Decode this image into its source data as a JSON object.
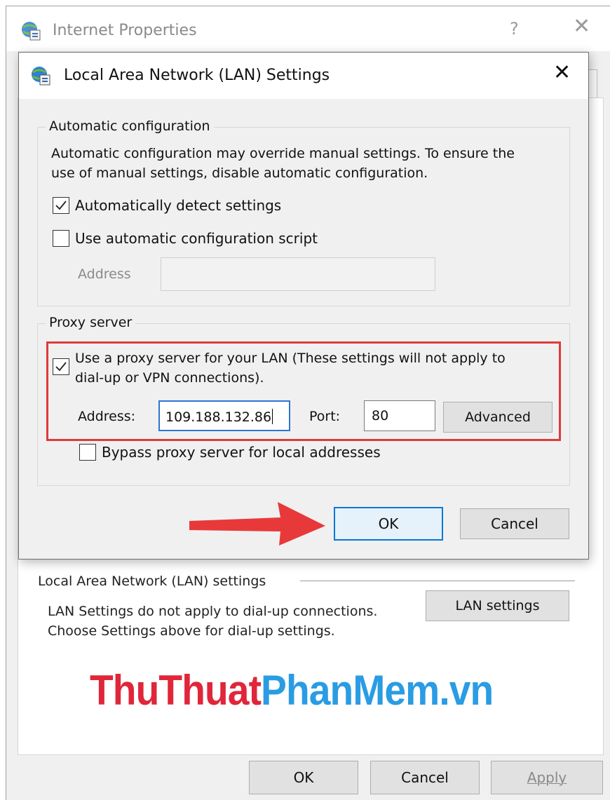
{
  "outer_window": {
    "title": "Internet Properties",
    "help": "?",
    "close": "✕",
    "lan_group": {
      "title": "Local Area Network (LAN) settings",
      "desc_line1": "LAN Settings do not apply to dial-up connections.",
      "desc_line2": "Choose Settings above for dial-up settings.",
      "button": "LAN settings"
    },
    "buttons": {
      "ok": "OK",
      "cancel": "Cancel",
      "apply": "Apply"
    }
  },
  "watermark": {
    "part1": "ThuThuat",
    "part2": "PhanMem",
    "part3": ".vn"
  },
  "dialog": {
    "title": "Local Area Network (LAN) Settings",
    "close": "✕",
    "auto_config": {
      "label": "Automatic configuration",
      "desc_line1": "Automatic configuration may override manual settings.  To ensure the",
      "desc_line2": "use of manual settings, disable automatic configuration.",
      "auto_detect_label": "Automatically detect settings",
      "auto_detect_checked": true,
      "script_label": "Use automatic configuration script",
      "script_checked": false,
      "address_label": "Address",
      "address_value": ""
    },
    "proxy": {
      "label": "Proxy server",
      "use_proxy_line1": "Use a proxy server for your LAN (These settings will not apply to",
      "use_proxy_line2": "dial-up or VPN connections).",
      "use_proxy_checked": true,
      "address_label": "Address:",
      "address_value": "109.188.132.86",
      "port_label": "Port:",
      "port_value": "80",
      "advanced": "Advanced",
      "bypass_label": "Bypass proxy server for local addresses",
      "bypass_checked": false
    },
    "ok": "OK",
    "cancel": "Cancel"
  },
  "colors": {
    "highlight": "#e03a3a",
    "arrow": "#e8393a",
    "focus": "#0078d7"
  }
}
